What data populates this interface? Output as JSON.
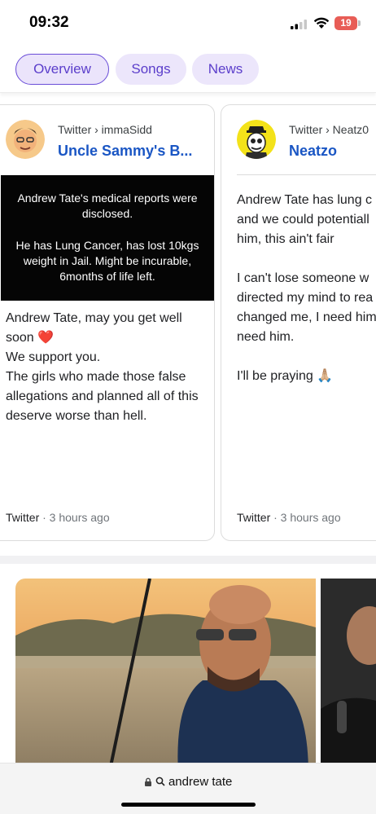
{
  "status_bar": {
    "time": "09:32",
    "battery": "19"
  },
  "tabs": [
    {
      "label": "Overview"
    },
    {
      "label": "Songs"
    },
    {
      "label": "News"
    }
  ],
  "cards": [
    {
      "source": "Twitter › immaSidd",
      "author": "Uncle Sammy's B...",
      "embed_lines": [
        "Andrew Tate's medical reports were disclosed.",
        "He has Lung Cancer, has lost 10kgs weight in Jail. Might be incurable, 6months of life left."
      ],
      "text": "Andrew Tate, may you get well soon ❤️\nWe support you.\nThe girls who made those false allegations and planned all of this deserve worse than hell.",
      "footer_source": "Twitter",
      "footer_time": " · 3 hours ago"
    },
    {
      "source": "Twitter › Neatz0",
      "author": "Neatzo",
      "text": "Andrew Tate has lung c\nand we could potentiall\nhim, this ain't fair\n\nI can't lose someone w\ndirected my mind to rea\nchanged me, I need him\nneed him.\n\nI'll be praying 🙏🏼",
      "footer_source": "Twitter",
      "footer_time": " · 3 hours ago"
    }
  ],
  "address_bar": {
    "query": "andrew tate"
  },
  "colors": {
    "accent": "#6a4dd8",
    "link": "#1a56c4",
    "chip_bg": "#ece6fb"
  }
}
